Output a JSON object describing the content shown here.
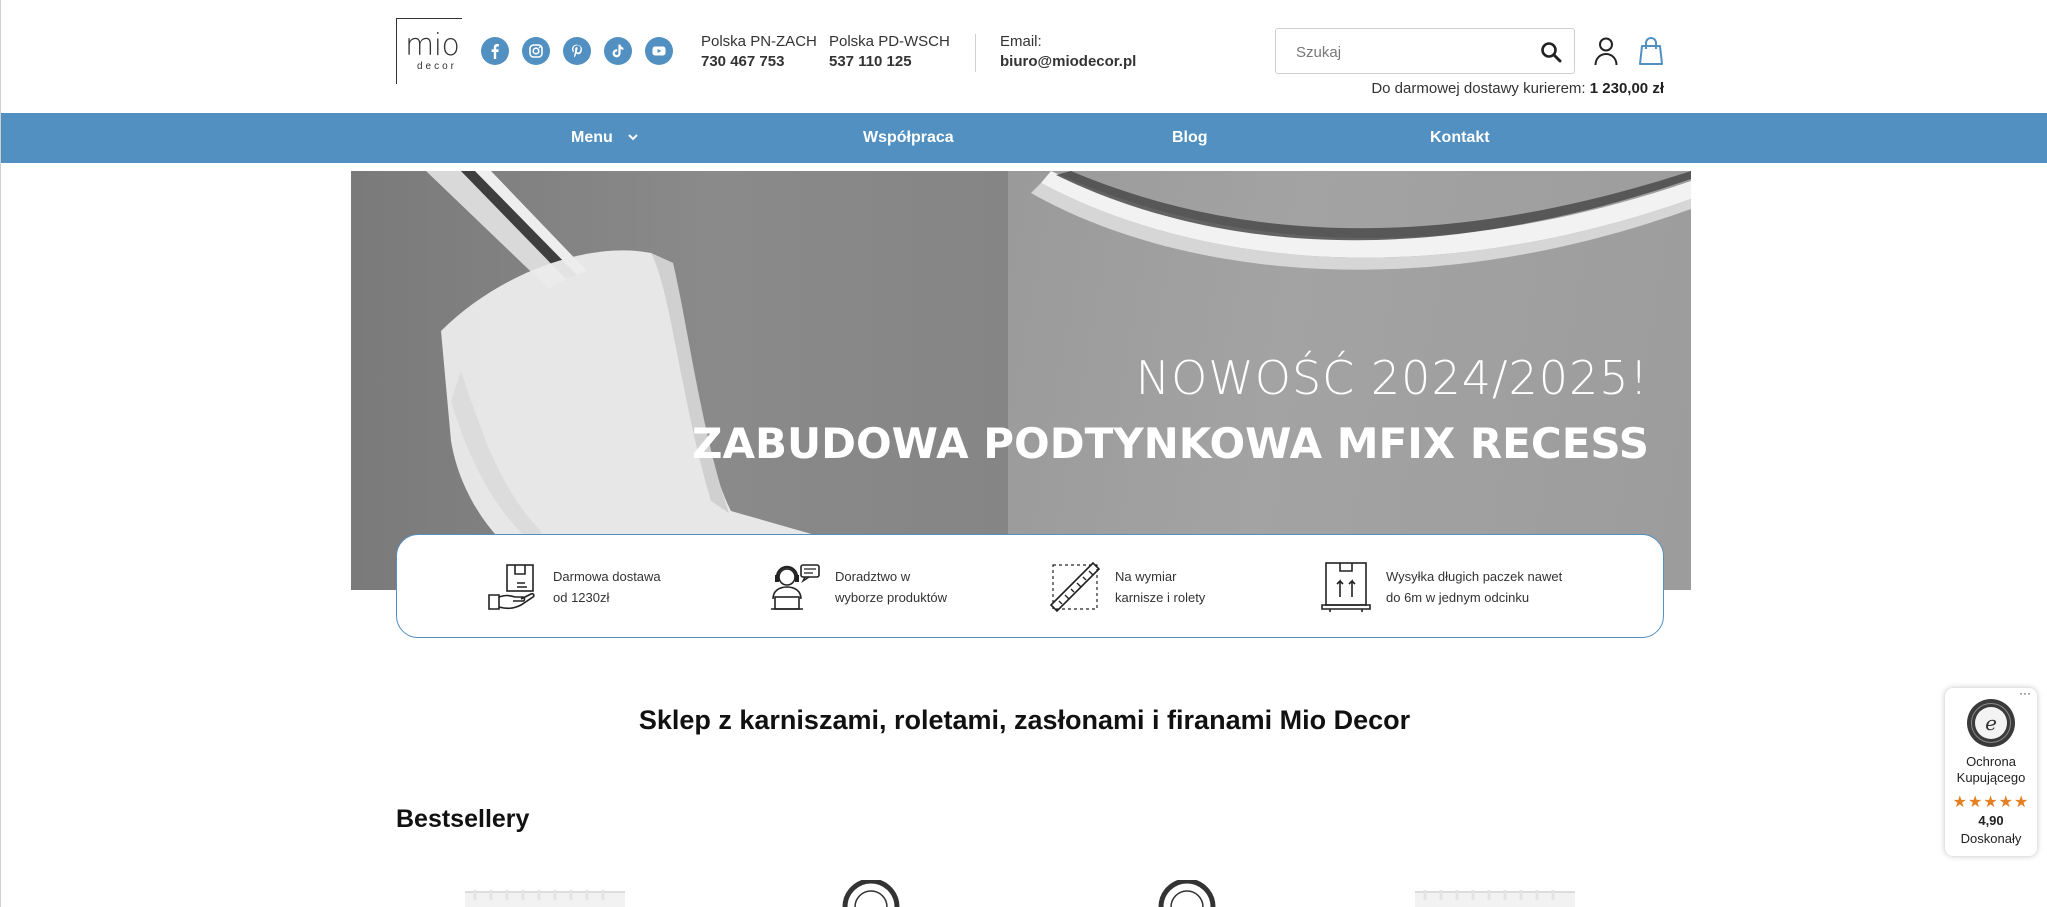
{
  "brand": {
    "logo_main": "mio",
    "logo_sub": "decor"
  },
  "header": {
    "socials": [
      {
        "icon": "facebook-icon"
      },
      {
        "icon": "instagram-icon"
      },
      {
        "icon": "pinterest-icon"
      },
      {
        "icon": "tiktok-icon"
      },
      {
        "icon": "youtube-icon"
      }
    ],
    "contacts": [
      {
        "label": "Polska PN-ZACH",
        "value": "730 467 753"
      },
      {
        "label": "Polska PD-WSCH",
        "value": "537 110 125"
      },
      {
        "label": "Email:",
        "value": "biuro@miodecor.pl"
      }
    ],
    "search": {
      "placeholder": "Szukaj"
    },
    "free_shipping_text": "Do darmowej dostawy kurierem:",
    "free_shipping_amount": "1 230,00 zł"
  },
  "nav": {
    "items": [
      "Menu",
      "Współpraca",
      "Blog",
      "Kontakt"
    ]
  },
  "hero": {
    "line1": "NOWOŚĆ 2024/2025!",
    "line2": "ZABUDOWA PODTYNKOWA MFIX RECESS"
  },
  "benefits": [
    {
      "icon": "delivery-box-icon",
      "line1": "Darmowa dostawa",
      "line2": "od 1230zł"
    },
    {
      "icon": "consultant-icon",
      "line1": "Doradztwo w",
      "line2": "wyborze produktów"
    },
    {
      "icon": "measure-ruler-icon",
      "line1": "Na wymiar",
      "line2": "karnisze i rolety"
    },
    {
      "icon": "long-package-icon",
      "line1": "Wysyłka długich paczek nawet",
      "line2": "do 6m w jednym odcinku"
    }
  ],
  "section_title": "Sklep z karniszami, roletami, zasłonami i firanami Mio Decor",
  "bestsellers_title": "Bestsellery",
  "trust_badge": {
    "label_line1": "Ochrona",
    "label_line2": "Kupującego",
    "stars": "★★★★★",
    "rating": 4.9,
    "score": "4,90",
    "verdict": "Doskonały",
    "menu": "···"
  },
  "colors": {
    "accent": "#5190c0",
    "star": "#e47f22"
  }
}
